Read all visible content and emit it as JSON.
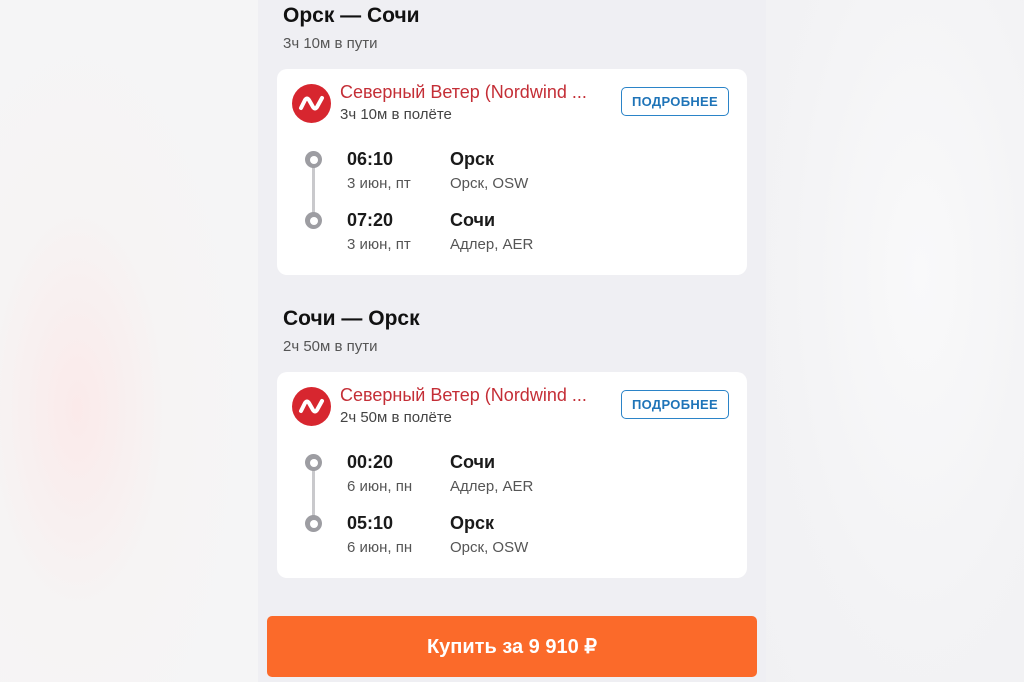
{
  "colors": {
    "airline_red": "#d7262f",
    "button_blue": "#2b84c8",
    "buy_orange": "#fb6a2a"
  },
  "segments": [
    {
      "title": "Орск — Сочи",
      "total_duration": "3ч 10м в пути",
      "airline": "Северный Ветер (Nordwind ...",
      "flight_duration": "3ч 10м в полёте",
      "details_label": "ПОДРОБНЕЕ",
      "logo_icon": "nordwind-logo-icon",
      "departure": {
        "time": "06:10",
        "date": "3 июн, пт",
        "city": "Орск",
        "airport": "Орск, OSW"
      },
      "arrival": {
        "time": "07:20",
        "date": "3 июн, пт",
        "city": "Сочи",
        "airport": "Адлер, AER"
      }
    },
    {
      "title": "Сочи — Орск",
      "total_duration": "2ч 50м в пути",
      "airline": "Северный Ветер (Nordwind ...",
      "flight_duration": "2ч 50м в полёте",
      "details_label": "ПОДРОБНЕЕ",
      "logo_icon": "nordwind-logo-icon",
      "departure": {
        "time": "00:20",
        "date": "6 июн, пн",
        "city": "Сочи",
        "airport": "Адлер, AER"
      },
      "arrival": {
        "time": "05:10",
        "date": "6 июн, пн",
        "city": "Орск",
        "airport": "Орск, OSW"
      }
    }
  ],
  "buy_button": {
    "label": "Купить за 9 910 ₽"
  }
}
